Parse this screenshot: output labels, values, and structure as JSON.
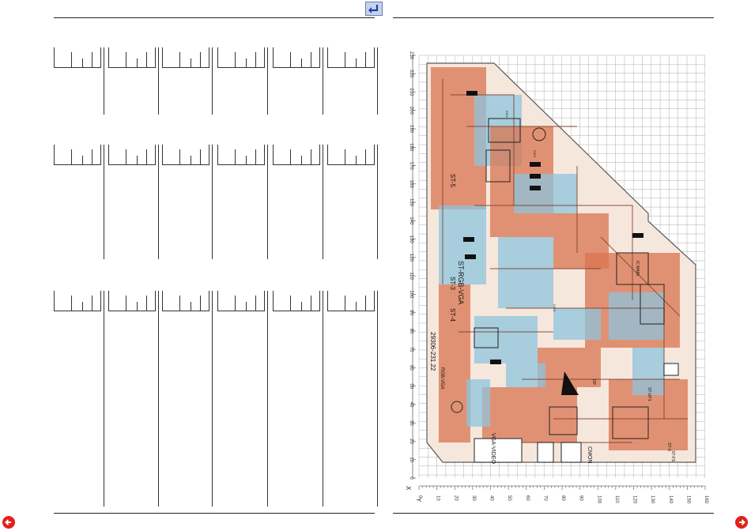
{
  "nav": {
    "back_label": "Back",
    "prev_label": "Previous page",
    "next_label": "Next page"
  },
  "board": {
    "y_axis_label": "Y",
    "x_axis_label": "X",
    "y_ticks": [
      "0",
      "10",
      "20",
      "30",
      "40",
      "50",
      "60",
      "70",
      "80",
      "90",
      "100",
      "110",
      "120",
      "130",
      "140",
      "150",
      "160"
    ],
    "x_ticks": [
      "0",
      "10",
      "20",
      "30",
      "40",
      "50",
      "60",
      "70",
      "80",
      "90",
      "100",
      "110",
      "120",
      "130",
      "140",
      "150",
      "160",
      "170",
      "180",
      "190",
      "200",
      "210",
      "220",
      "230"
    ],
    "labels": {
      "st_rgb": "ST-RGB-VGA",
      "st_3": "ST-3",
      "st_4": "ST-4",
      "st_5": "ST-5",
      "part_no": "29306-231.22",
      "part_sub": "RGB-VGA",
      "vga_video": "VGA-VIDEO",
      "st_up": "ST-UP1",
      "st_fs": "ST-FS",
      "st_s": "ST-S",
      "ic_main": "IC MAIN",
      "dp": "DP",
      "cmon": "CMON",
      "c_ic1": "CIC1",
      "c_ic2": "CIC2",
      "c_ic3": "CIC3"
    }
  },
  "colors": {
    "copper_top": "#d9744f",
    "copper_bottom": "#8ec4dc",
    "grid": "#9a9a9a",
    "board_outline": "#5a5a5a"
  }
}
